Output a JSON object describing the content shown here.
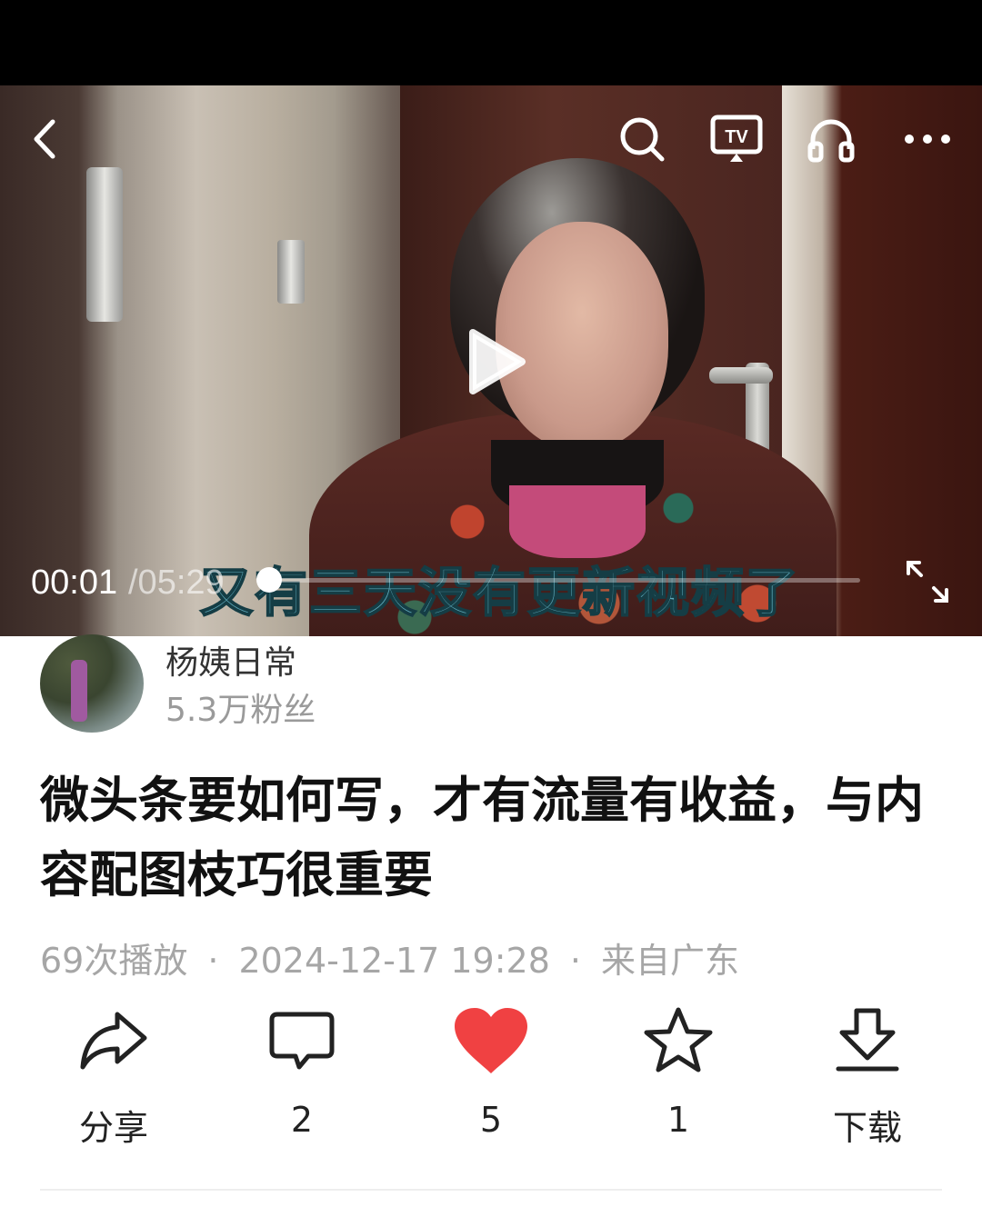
{
  "player": {
    "current_time": "00:01",
    "total_time": "/05:29",
    "subtitle": "又有三天没有更新视频了",
    "progress": 0.003
  },
  "top_icons": [
    "back-icon",
    "search-icon",
    "tv-cast-icon",
    "headphones-icon",
    "more-icon"
  ],
  "author": {
    "name": "杨姨日常",
    "fans": "5.3万粉丝"
  },
  "post": {
    "title": "微头条要如何写，才有流量有收益，与内容配图枝巧很重要",
    "plays": "69次播放",
    "datetime": "2024-12-17 19:28",
    "location": "来自广东",
    "separator": "·"
  },
  "actions": {
    "share_label": "分享",
    "comment_count": "2",
    "like_count": "5",
    "favorite_count": "1",
    "download_label": "下载",
    "like_color": "#f04142"
  }
}
